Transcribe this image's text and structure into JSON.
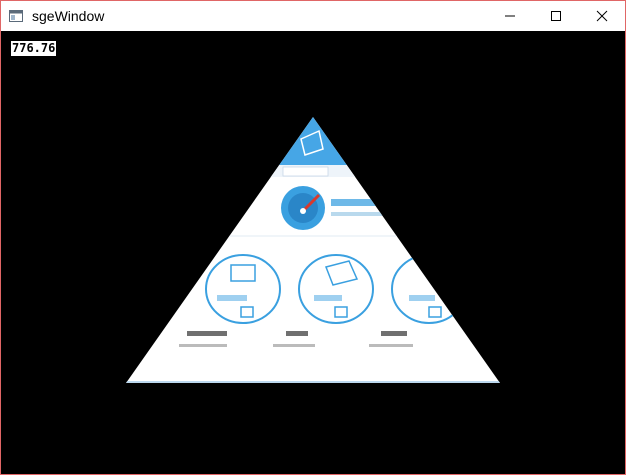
{
  "window": {
    "title": "sgeWindow",
    "border_color": "#e06666",
    "client_bg": "#000000"
  },
  "controls": {
    "minimize_icon": "minimize-icon",
    "maximize_icon": "maximize-icon",
    "close_icon": "close-icon"
  },
  "hud": {
    "fps_value": "776.76"
  },
  "render": {
    "shape": "triangle",
    "texture_desc_colors": {
      "header_blue": "#46a6e6",
      "ring_blue": "#3aa0e0",
      "gauge_red": "#d9392d",
      "base_white": "#ffffff"
    }
  }
}
